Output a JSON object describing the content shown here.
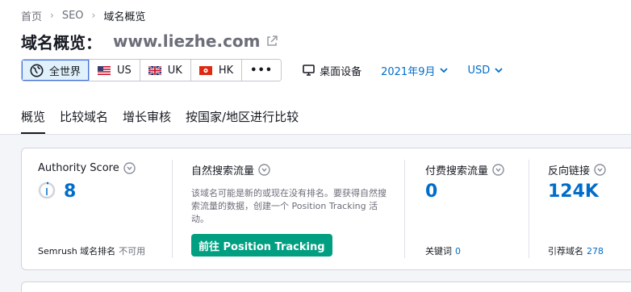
{
  "breadcrumb": {
    "home": "首页",
    "seo": "SEO",
    "current": "域名概览"
  },
  "header": {
    "title": "域名概览：",
    "domain": "www.liezhe.com"
  },
  "database_selector": {
    "items": [
      {
        "label": "全世界",
        "icon": "globe-icon",
        "selected": true
      },
      {
        "label": "US",
        "icon": "us-flag-icon"
      },
      {
        "label": "UK",
        "icon": "uk-flag-icon"
      },
      {
        "label": "HK",
        "icon": "hk-flag-icon"
      }
    ],
    "more": "•••"
  },
  "device": {
    "label": "桌面设备",
    "icon": "monitor-icon"
  },
  "date": {
    "label": "2021年9月"
  },
  "currency": {
    "label": "USD"
  },
  "tabs": [
    {
      "label": "概览",
      "active": true
    },
    {
      "label": "比较域名"
    },
    {
      "label": "增长审核"
    },
    {
      "label": "按国家/地区进行比较"
    }
  ],
  "metrics": {
    "authority": {
      "label": "Authority Score",
      "value": "8",
      "rank_label": "Semrush 域名排名",
      "rank_value": "不可用"
    },
    "organic": {
      "label": "自然搜索流量",
      "description": "该域名可能是新的或现在没有排名。要获得自然搜索流量的数据，创建一个 Position Tracking 活动。",
      "cta": "前往 Position Tracking"
    },
    "paid": {
      "label": "付费搜索流量",
      "value": "0",
      "keywords_label": "关键词",
      "keywords_value": "0"
    },
    "backlinks": {
      "label": "反向链接",
      "value": "124K",
      "ref_label": "引荐域名",
      "ref_value": "278"
    }
  },
  "colors": {
    "accent": "#006DCA",
    "cta": "#009F81",
    "selected_bg": "#E0F1FB"
  }
}
